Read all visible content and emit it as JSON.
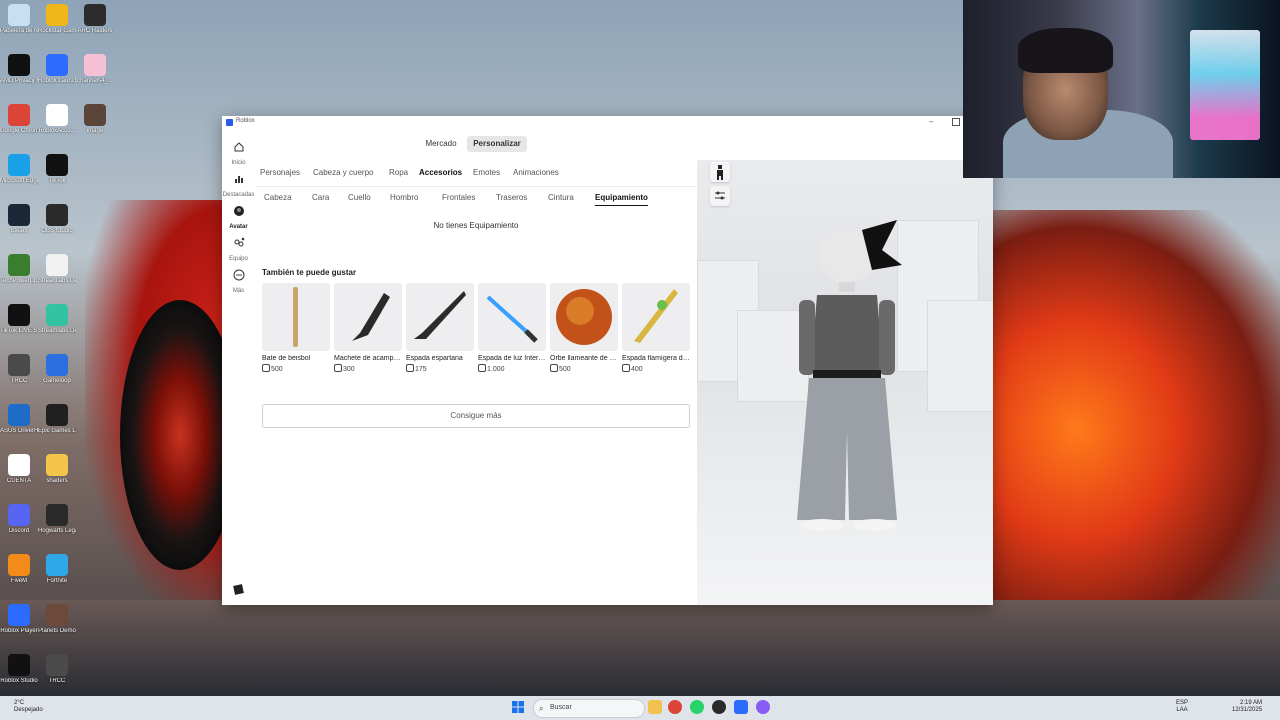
{
  "desktop": {
    "icons": [
      {
        "label": "Papelera de reciclaje",
        "color": "#c7dff2"
      },
      {
        "label": "Rockstar Games...",
        "color": "#f1b71a"
      },
      {
        "label": "ARC Raiders",
        "color": "#2c2c2c"
      },
      {
        "label": "AMD Privacy View",
        "color": "#111111"
      },
      {
        "label": "Roblox Launcher",
        "color": "#2b6cff"
      },
      {
        "label": "channels4_...",
        "color": "#f6c1d6"
      },
      {
        "label": "Google Chrome",
        "color": "#db4437"
      },
      {
        "label": "RobloxAcco...",
        "color": "#ffffff"
      },
      {
        "label": "image",
        "color": "#5b4438"
      },
      {
        "label": "Microsoft Edge",
        "color": "#1aa0e8"
      },
      {
        "label": "TikTok",
        "color": "#111111"
      },
      {
        "label": "Steam",
        "color": "#1b2838"
      },
      {
        "label": "OBS Studio",
        "color": "#2a2a2a"
      },
      {
        "label": "TechPowerUp GPU-Z",
        "color": "#3b7d2f"
      },
      {
        "label": "Streamlabs Desktop",
        "color": "#f2f2f2"
      },
      {
        "label": "TikTok LIVE Studio",
        "color": "#111111"
      },
      {
        "label": "Streamlabs Desktop",
        "color": "#31c3a2"
      },
      {
        "label": "TRCC",
        "color": "#4a4a4a"
      },
      {
        "label": "Gameloop",
        "color": "#2a6ee0"
      },
      {
        "label": "ASUS DriverHub",
        "color": "#1d6cc7"
      },
      {
        "label": "Epic Games Launcher",
        "color": "#202020"
      },
      {
        "label": "CUENTA",
        "color": "#ffffff"
      },
      {
        "label": "shaders",
        "color": "#f3c54a"
      },
      {
        "label": "Discord",
        "color": "#5865f2"
      },
      {
        "label": "Hogwarts Legacy",
        "color": "#2a2a2a"
      },
      {
        "label": "FiveM",
        "color": "#f28b1a"
      },
      {
        "label": "Fortnite",
        "color": "#2fa8e8"
      },
      {
        "label": "Roblox Player",
        "color": "#2b6cff"
      },
      {
        "label": "Planets Demo",
        "color": "#6b4a3a"
      },
      {
        "label": "Roblox Studio",
        "color": "#111111"
      },
      {
        "label": "TRCC",
        "color": "#4a4a4a"
      }
    ]
  },
  "window": {
    "title": "Roblox",
    "sidenav": [
      {
        "label": "Inicio",
        "icon": "home-icon"
      },
      {
        "label": "Destacadas",
        "icon": "chart-icon"
      },
      {
        "label": "Avatar",
        "icon": "avatar-icon",
        "active": true
      },
      {
        "label": "Equipo",
        "icon": "group-icon"
      },
      {
        "label": "Más",
        "icon": "more-icon"
      }
    ],
    "segment": {
      "market": "Mercado",
      "customize": "Personalizar"
    },
    "categories": [
      "Personajes",
      "Cabeza y cuerpo",
      "Ropa",
      "Accesorios",
      "Emotes",
      "Animaciones"
    ],
    "active_category": "Accesorios",
    "subcategories": [
      "Cabeza",
      "Cara",
      "Cuello",
      "Hombro",
      "Frontales",
      "Traseros",
      "Cintura",
      "Equipamiento"
    ],
    "active_subcategory": "Equipamiento",
    "empty_text": "No tienes Equipamiento",
    "recommend_title": "También te puede gustar",
    "items": [
      {
        "name": "Bate de béisbol",
        "price": "500"
      },
      {
        "name": "Machete de acampada",
        "price": "300"
      },
      {
        "name": "Espada espartana",
        "price": "175"
      },
      {
        "name": "Espada de luz Intergaláctica",
        "price": "1.000"
      },
      {
        "name": "Orbe llameante de fuego",
        "price": "500"
      },
      {
        "name": "Espada flamígera dorada",
        "price": "400"
      }
    ],
    "more_button": "Consigue más"
  },
  "taskbar": {
    "weather_temp": "2°C",
    "weather_desc": "Despejado",
    "search_placeholder": "Buscar",
    "lang": "ESP",
    "lang_sub": "LAA",
    "time": "2:19 AM",
    "date": "12/31/2025"
  },
  "colors": {
    "accent": "#2a5be8",
    "active_text": "#111111"
  }
}
